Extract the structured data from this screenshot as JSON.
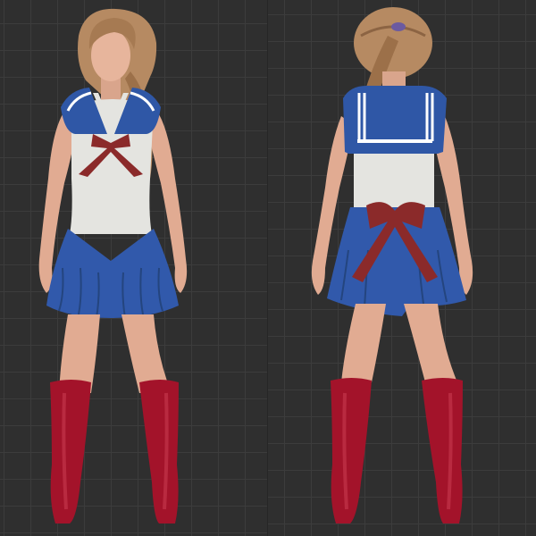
{
  "views": [
    {
      "id": "front",
      "facing": "front"
    },
    {
      "id": "back",
      "facing": "back"
    }
  ],
  "colors": {
    "background": "#2f2f2f",
    "grid_line": "#3c3c3c",
    "skin": "#e7b59c",
    "skin_shadow": "#c98f76",
    "hair": "#b68a62",
    "hair_shadow": "#8c6443",
    "bodice_white": "#e4e4e0",
    "sailor_collar_blue": "#2f57a6",
    "skirt_blue": "#3159ab",
    "bow_red": "#8b2a2a",
    "boot_red": "#a3132a"
  }
}
